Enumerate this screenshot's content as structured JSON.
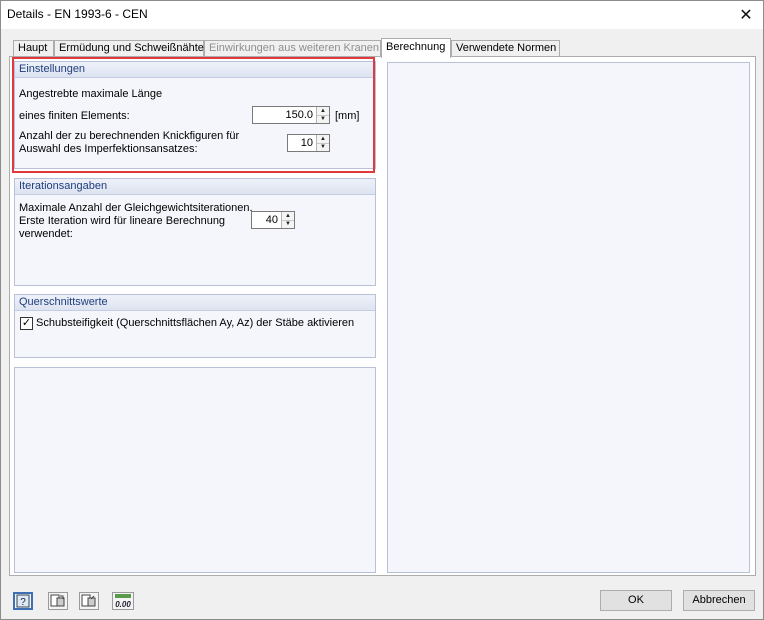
{
  "window": {
    "title": "Details - EN 1993-6 - CEN",
    "close_glyph": "✕"
  },
  "tabs": [
    {
      "label": "Haupt",
      "state": "normal"
    },
    {
      "label": "Ermüdung und Schweißnähte",
      "state": "normal"
    },
    {
      "label": "Einwirkungen aus weiteren Kranen",
      "state": "disabled"
    },
    {
      "label": "Berechnung",
      "state": "active"
    },
    {
      "label": "Verwendete Normen",
      "state": "normal"
    }
  ],
  "einstellungen": {
    "title": "Einstellungen",
    "length_label_1": "Angestrebte maximale Länge",
    "length_label_2": "eines finiten Elements:",
    "length_value": "150.0",
    "length_unit": "[mm]",
    "buckling_label_1": "Anzahl der zu berechnenden Knickfiguren für",
    "buckling_label_2": "Auswahl des Imperfektionsansatzes:",
    "buckling_value": "10"
  },
  "iteration": {
    "title": "Iterationsangaben",
    "label_1": "Maximale Anzahl der Gleichgewichtsiterationen.",
    "label_2": "Erste Iteration wird für lineare Berechnung",
    "label_3": "verwendet:",
    "value": "40"
  },
  "querschnitt": {
    "title": "Querschnittswerte",
    "checkbox_label": "Schubsteifigkeit (Querschnittsflächen Ay, Az) der Stäbe aktivieren",
    "checked": true
  },
  "footer": {
    "icons": [
      "help-icon",
      "export-icon",
      "import-icon",
      "decimal-places-icon"
    ],
    "decimal_icon_text": "0.00",
    "ok_label": "OK",
    "cancel_label": "Abbrechen"
  },
  "colors": {
    "highlight": "#e0393e",
    "group_title": "#1f3e7c"
  }
}
